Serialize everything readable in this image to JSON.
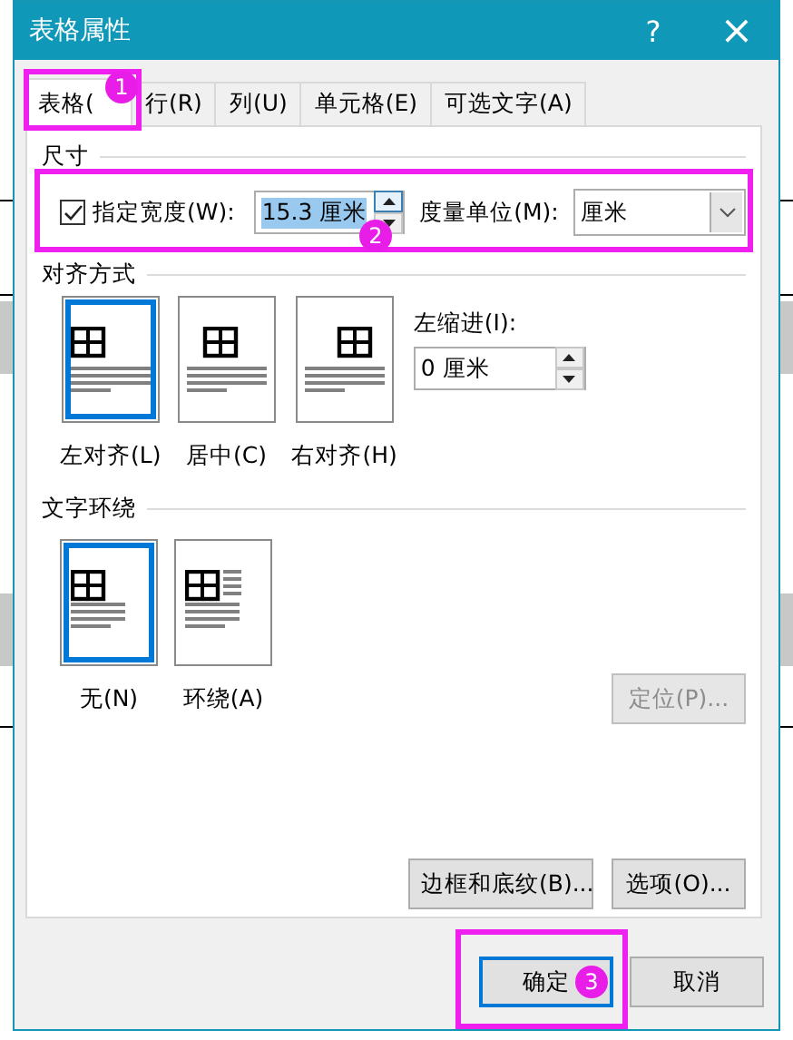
{
  "window": {
    "title": "表格属性",
    "help": "?",
    "close": "×"
  },
  "tabs": [
    {
      "label": "表格(",
      "selected": true,
      "annotation": "1"
    },
    {
      "label": "行(R)",
      "selected": false
    },
    {
      "label": "列(U)",
      "selected": false
    },
    {
      "label": "单元格(E)",
      "selected": false
    },
    {
      "label": "可选文字(A)",
      "selected": false
    }
  ],
  "size": {
    "heading": "尺寸",
    "annotation": "2",
    "width_check": {
      "label": "指定宽度(W):",
      "checked": true
    },
    "width": {
      "value": "15.3 厘米",
      "highlighted": true
    },
    "unit": {
      "label": "度量单位(M):",
      "value": "厘米"
    }
  },
  "alignment": {
    "heading": "对齐方式",
    "options": [
      {
        "label": "左对齐(L)",
        "kind": "left",
        "selected": true
      },
      {
        "label": "居中(C)",
        "kind": "center",
        "selected": false
      },
      {
        "label": "右对齐(H)",
        "kind": "right",
        "selected": false
      }
    ],
    "indent": {
      "label": "左缩进(I):",
      "value": "0 厘米"
    }
  },
  "wrapping": {
    "heading": "文字环绕",
    "options": [
      {
        "label": "无(N)",
        "kind": "none",
        "selected": true
      },
      {
        "label": "环绕(A)",
        "kind": "around",
        "selected": false
      }
    ],
    "position_button": {
      "label": "定位(P)...",
      "disabled": true
    }
  },
  "panel_buttons": [
    {
      "label": "边框和底纹(B)..."
    },
    {
      "label": "选项(O)..."
    }
  ],
  "footer": [
    {
      "label": "确定",
      "default": true,
      "annotation": "3"
    },
    {
      "label": "取消",
      "default": false
    }
  ]
}
